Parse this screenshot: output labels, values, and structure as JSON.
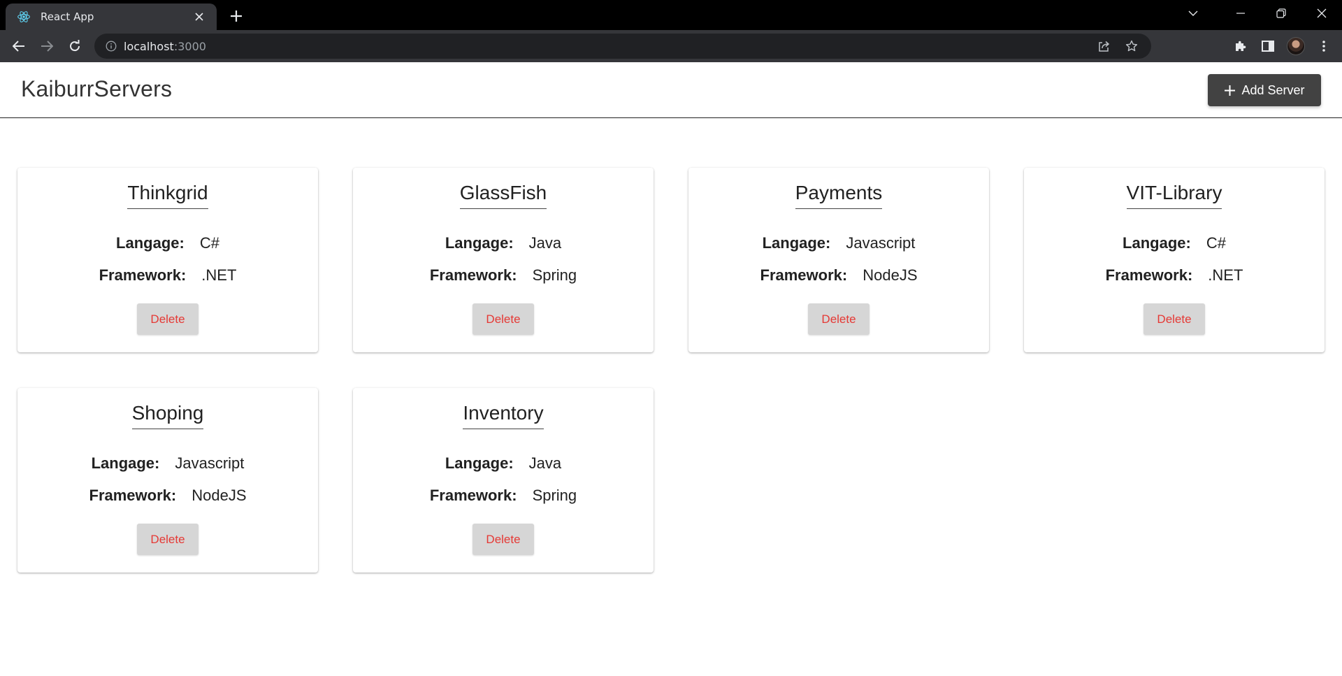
{
  "browser": {
    "tab_title": "React App",
    "url_host": "localhost",
    "url_port": ":3000"
  },
  "header": {
    "brand": "KaiburrServers",
    "add_button_label": "Add Server"
  },
  "labels": {
    "language": "Langage:",
    "framework": "Framework:",
    "delete": "Delete"
  },
  "servers": [
    {
      "name": "Thinkgrid",
      "language": "C#",
      "framework": ".NET"
    },
    {
      "name": "GlassFish",
      "language": "Java",
      "framework": "Spring"
    },
    {
      "name": "Payments",
      "language": "Javascript",
      "framework": "NodeJS"
    },
    {
      "name": "VIT-Library",
      "language": "C#",
      "framework": ".NET"
    },
    {
      "name": "Shoping",
      "language": "Javascript",
      "framework": "NodeJS"
    },
    {
      "name": "Inventory",
      "language": "Java",
      "framework": "Spring"
    }
  ],
  "colors": {
    "delete_text": "#e53935",
    "add_button_bg": "#424242"
  }
}
